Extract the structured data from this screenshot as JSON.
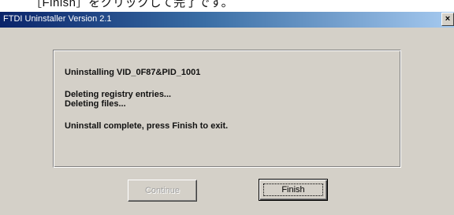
{
  "caption": "［Finish］をクリックして完了です。",
  "window": {
    "title": "FTDI Uninstaller Version 2.1",
    "close_glyph": "×"
  },
  "messages": {
    "uninstalling": "Uninstalling VID_0F87&PID_1001",
    "deleting_registry": "Deleting registry entries...",
    "deleting_files": "Deleting files...",
    "complete": "Uninstall complete, press Finish to exit."
  },
  "buttons": {
    "continue_label": "Continue",
    "finish_label": "Finish"
  }
}
